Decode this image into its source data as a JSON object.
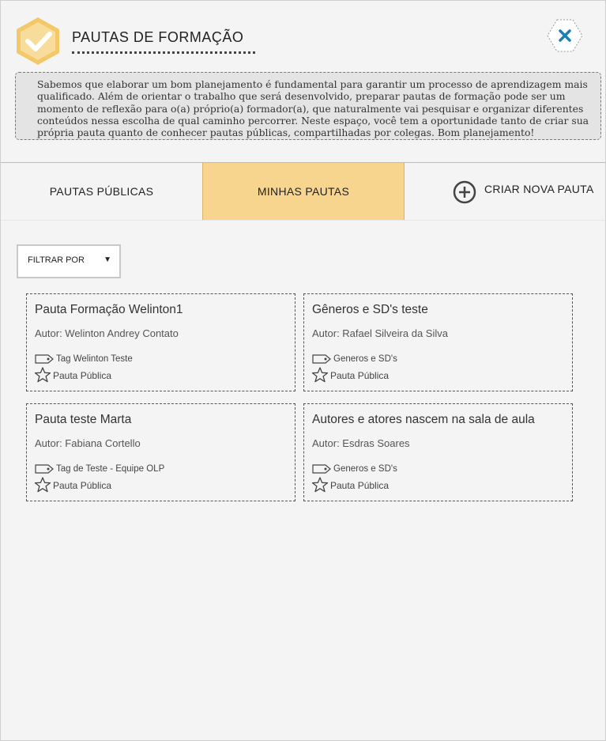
{
  "header": {
    "title": "PAUTAS DE FORMAÇÃO",
    "logo_icon": "checkmark-hexagon-icon",
    "close_icon": "close-icon",
    "brand_color": "#f7d58e",
    "close_color": "#1a7fb5"
  },
  "intro": {
    "text": "Sabemos que elaborar um bom planejamento é fundamental para garantir um processo de aprendizagem mais qualificado. Além de orientar o trabalho que será desenvolvido, preparar pautas de formação pode ser um momento de reflexão para o(a) próprio(a) formador(a), que naturalmente vai pesquisar e organizar diferentes conteúdos nessa escolha de qual caminho percorrer. Neste espaço, você tem a oportunidade tanto de criar sua própria pauta quanto de conhecer pautas públicas, compartilhadas por colegas. Bom planejamento!"
  },
  "tabs": {
    "public_label": "PAUTAS PÚBLICAS",
    "mine_label": "MINHAS PAUTAS",
    "create_label": "CRIAR NOVA PAUTA",
    "active": "MINHAS PAUTAS"
  },
  "filter": {
    "label": "FILTRAR POR",
    "arrow": "▼"
  },
  "cards": [
    {
      "title": "Pauta Formação Welinton1",
      "author": "Autor: Welinton Andrey Contato",
      "tag": "Tag Welinton Teste",
      "visibility": "Pauta Pública"
    },
    {
      "title": "Gêneros e SD's teste",
      "author": "Autor: Rafael Silveira da Silva",
      "tag": "Generos e SD's",
      "visibility": "Pauta Pública"
    },
    {
      "title": "Pauta teste Marta",
      "author": "Autor: Fabiana Cortello",
      "tag": "Tag de Teste - Equipe OLP",
      "visibility": "Pauta Pública"
    },
    {
      "title": "Autores e atores nascem na sala de aula",
      "author": "Autor: Esdras Soares",
      "tag": "Generos e SD's",
      "visibility": "Pauta Pública"
    }
  ]
}
